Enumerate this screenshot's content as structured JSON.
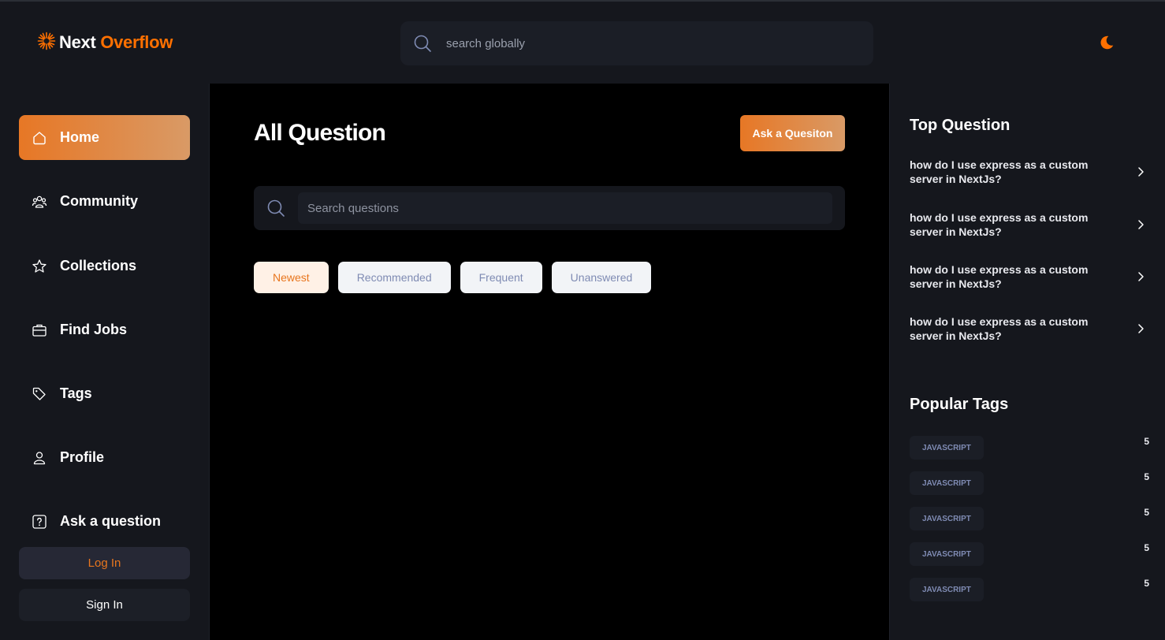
{
  "brand": {
    "name_part1": "Next",
    "name_part2": "Overflow",
    "accent_color": "#ff7000"
  },
  "header": {
    "search_placeholder": "search globally",
    "theme_icon": "moon-icon"
  },
  "sidebar": {
    "items": [
      {
        "label": "Home",
        "icon": "home-icon",
        "active": true
      },
      {
        "label": "Community",
        "icon": "users-icon",
        "active": false
      },
      {
        "label": "Collections",
        "icon": "star-icon",
        "active": false
      },
      {
        "label": "Find Jobs",
        "icon": "briefcase-icon",
        "active": false
      },
      {
        "label": "Tags",
        "icon": "tag-icon",
        "active": false
      },
      {
        "label": "Profile",
        "icon": "user-icon",
        "active": false
      },
      {
        "label": "Ask a question",
        "icon": "question-icon",
        "active": false
      }
    ],
    "login_label": "Log In",
    "signin_label": "Sign In"
  },
  "main": {
    "title": "All Question",
    "ask_button_label": "Ask a Quesiton",
    "search_placeholder": "Search questions",
    "filters": [
      {
        "label": "Newest",
        "active": true
      },
      {
        "label": "Recommended",
        "active": false
      },
      {
        "label": "Frequent",
        "active": false
      },
      {
        "label": "Unanswered",
        "active": false
      }
    ]
  },
  "right_sidebar": {
    "top_questions_heading": "Top Question",
    "top_questions": [
      "how do I use express as a custom server in NextJs?",
      "how do I use express as a custom server in NextJs?",
      "how do I use express as a custom server in NextJs?",
      "how do I use express as a custom server in NextJs?"
    ],
    "popular_tags_heading": "Popular Tags",
    "popular_tags": [
      {
        "name": "JAVASCRIPT",
        "count": "5"
      },
      {
        "name": "JAVASCRIPT",
        "count": "5"
      },
      {
        "name": "JAVASCRIPT",
        "count": "5"
      },
      {
        "name": "JAVASCRIPT",
        "count": "5"
      },
      {
        "name": "JAVASCRIPT",
        "count": "5"
      }
    ]
  }
}
